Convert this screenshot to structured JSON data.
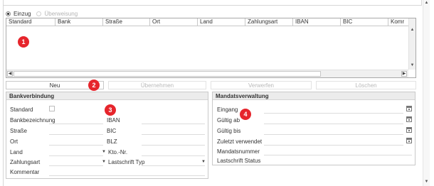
{
  "radio_options": [
    {
      "label": "Einzug",
      "selected": true
    },
    {
      "label": "Überweisung",
      "selected": false
    }
  ],
  "grid": {
    "columns": [
      "Standard",
      "Bank",
      "Straße",
      "Ort",
      "Land",
      "Zahlungsart",
      "IBAN",
      "BIC",
      "Komr"
    ],
    "rows": []
  },
  "markers": [
    "1",
    "2",
    "3",
    "4"
  ],
  "buttons": {
    "neu": "Neu",
    "uebernehmen": "Übernehmen",
    "verwerfen": "Verwerfen",
    "loeschen": "Löschen"
  },
  "bankverbindung": {
    "title": "Bankverbindung",
    "standard": "Standard",
    "bankbezeichnung": "Bankbezeichnung",
    "iban": "IBAN",
    "strasse": "Straße",
    "bic": "BIC",
    "ort": "Ort",
    "blz": "BLZ",
    "land": "Land",
    "ktonr": "Kto.-Nr.",
    "zahlungsart": "Zahlungsart",
    "lastschrift_typ": "Lastschrift Typ",
    "kommentar": "Kommentar"
  },
  "mandatsverwaltung": {
    "title": "Mandatsverwaltung",
    "eingang": "Eingang",
    "gueltig_ab": "Gültig ab",
    "gueltig_bis": "Gültig bis",
    "zuletzt_verwendet": "Zuletzt verwendet",
    "mandatsnummer": "Mandatsnummer",
    "lastschrift_status": "Lastschrift Status"
  },
  "colors": {
    "marker": "#e6252c",
    "group_header": "#ececec",
    "disabled_text": "#b8b8b8"
  },
  "icons": [
    "calendar-icon",
    "dropdown-arrow-icon",
    "scroll-up-icon",
    "scroll-down-icon",
    "scroll-left-icon",
    "scroll-right-icon"
  ]
}
